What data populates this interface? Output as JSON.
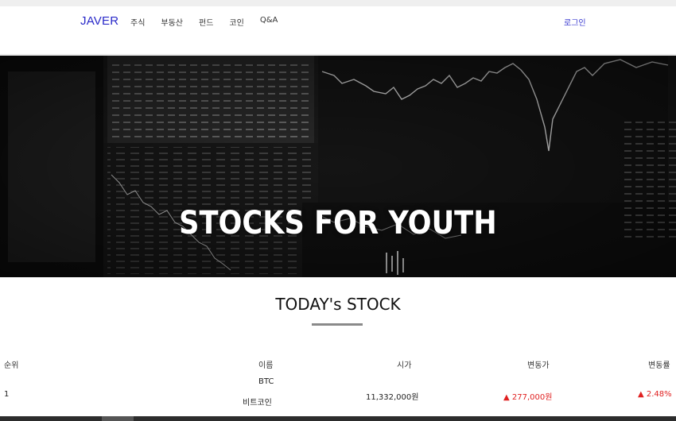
{
  "nav": {
    "brand": "JAVER",
    "items": [
      {
        "label": "주식"
      },
      {
        "label": "부동산"
      },
      {
        "label": "펀드"
      },
      {
        "label": "코인"
      },
      {
        "label": "Q&A"
      }
    ],
    "login": "로그인"
  },
  "hero": {
    "title": "STOCKS FOR YOUTH"
  },
  "section": {
    "title": "TODAY's STOCK"
  },
  "table": {
    "headers": [
      "순위",
      "이름",
      "시가",
      "변동가",
      "변동률"
    ],
    "rows": [
      {
        "rank": "1",
        "code": "BTC",
        "name": "비트코인",
        "price": "11,332,000원",
        "change": "▲ 277,000원",
        "rate": "▲ 2.48%"
      }
    ]
  },
  "colors": {
    "brand": "#2929c9",
    "up": "#e02020"
  }
}
